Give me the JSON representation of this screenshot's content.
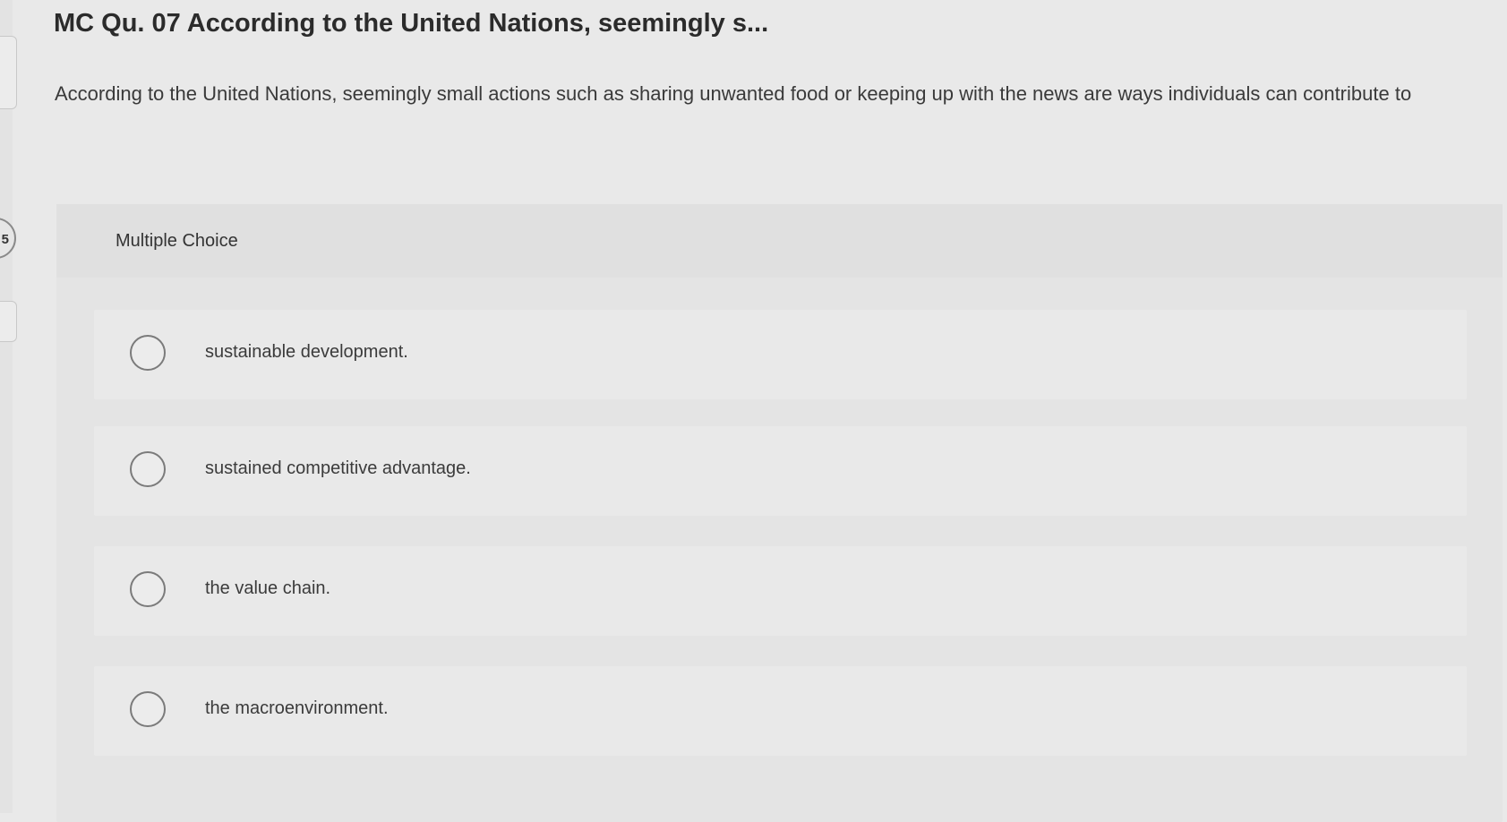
{
  "left_rail": {
    "badge": "5"
  },
  "question": {
    "title": "MC Qu. 07 According to the United Nations, seemingly s...",
    "prompt": "According to the United Nations, seemingly small actions such as sharing unwanted food or keeping up with the news are ways individuals can contribute to"
  },
  "multiple_choice": {
    "label": "Multiple Choice",
    "options": [
      {
        "text": "sustainable development.",
        "selected": false
      },
      {
        "text": "sustained competitive advantage.",
        "selected": false
      },
      {
        "text": "the value chain.",
        "selected": false
      },
      {
        "text": "the macroenvironment.",
        "selected": false
      }
    ]
  },
  "icons": {
    "radio": "radio-unselected-icon"
  },
  "colors": {
    "background": "#e9e9e9",
    "panel": "#e4e4e4",
    "radio_border": "#7b7b7b",
    "text": "#2b2b2b"
  }
}
